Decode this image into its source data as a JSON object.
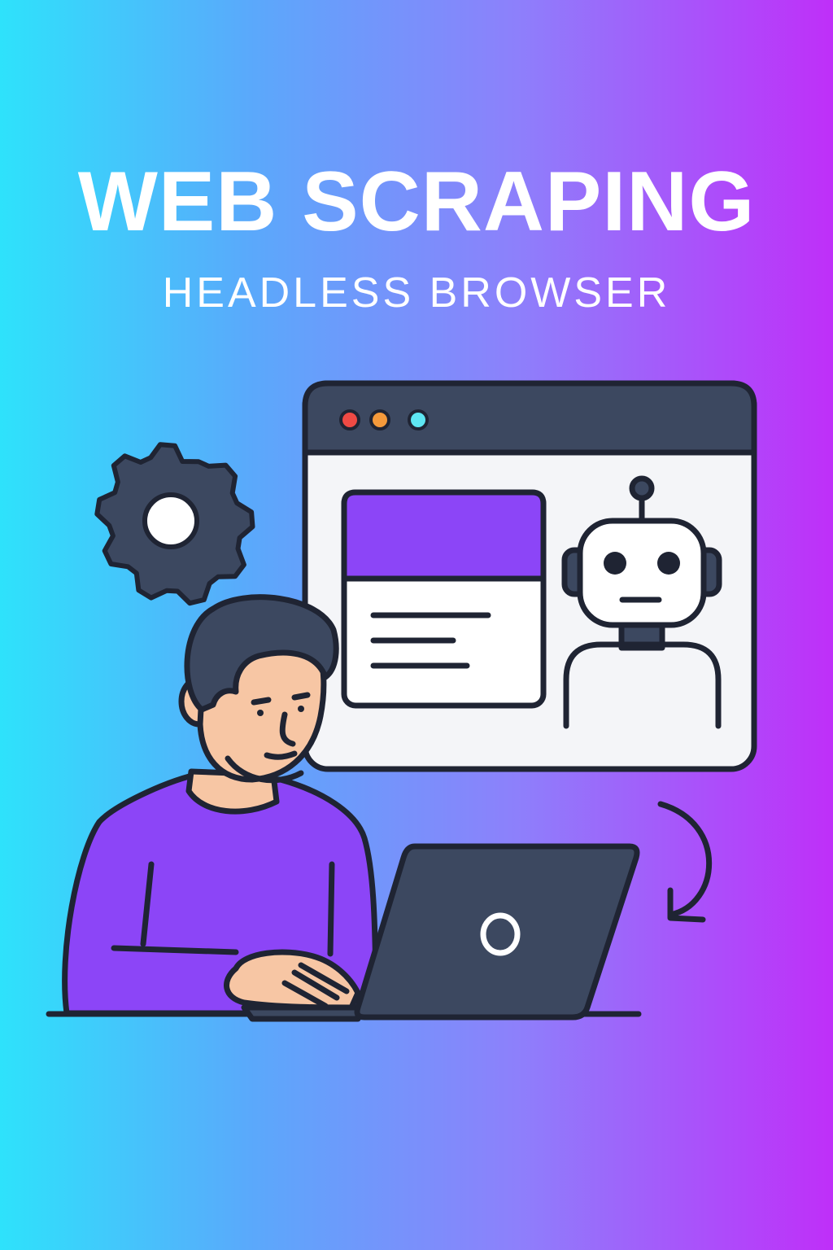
{
  "poster": {
    "title": "WEB SCRAPING",
    "subtitle": "HEADLESS BROWSER"
  },
  "palette": {
    "gradient_start": "#2ee2fb",
    "gradient_end": "#bf2ff9",
    "outline": "#1f2433",
    "dark_panel": "#3c4860",
    "purple": "#8c45f7",
    "skin": "#f7c6a4",
    "window_bg": "#f4f5f8"
  },
  "icons": {
    "gear": "gear-icon",
    "robot": "robot-icon",
    "arrow": "curved-arrow-icon",
    "laptop_logo": "circle-logo-icon"
  }
}
